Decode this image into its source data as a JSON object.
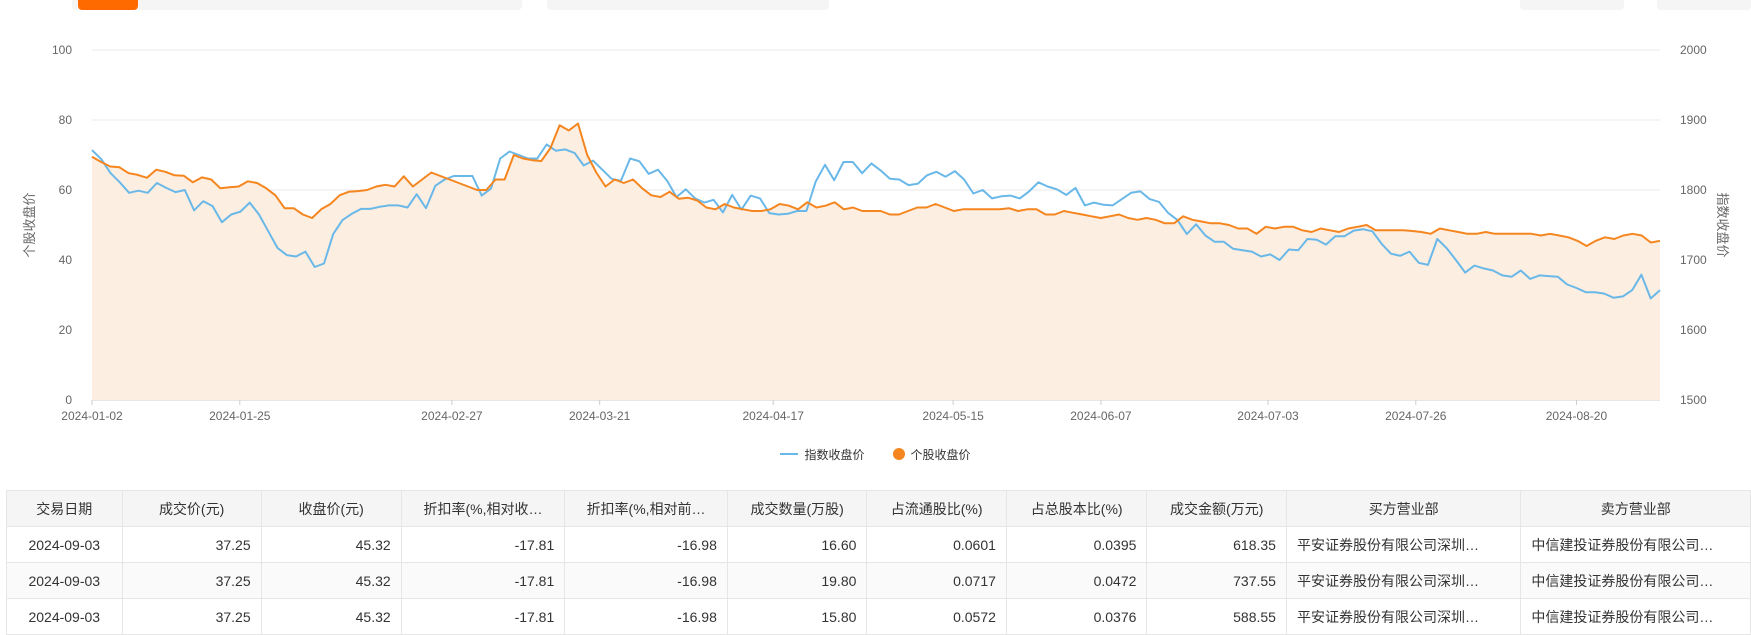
{
  "colors": {
    "index": "#6ab8e8",
    "stock": "#f5861f",
    "area": "#fdeee2",
    "active_tab": "#ff6a00"
  },
  "legend": {
    "index_label": "指数收盘价",
    "stock_label": "个股收盘价"
  },
  "chart_data": {
    "type": "line",
    "x_ticks": [
      "2024-01-02",
      "2024-01-25",
      "2024-02-27",
      "2024-03-21",
      "2024-04-17",
      "2024-05-15",
      "2024-06-07",
      "2024-07-03",
      "2024-07-26",
      "2024-08-20"
    ],
    "xlim": [
      "2024-01-02",
      "2024-09-02"
    ],
    "y_left": {
      "label": "个股收盘价",
      "min": 0,
      "max": 100,
      "ticks": [
        0,
        20,
        40,
        60,
        80,
        100
      ]
    },
    "y_right": {
      "label": "指数收盘价",
      "min": 1500,
      "max": 2000,
      "ticks": [
        1500,
        1600,
        1700,
        1800,
        1900,
        2000
      ]
    },
    "grid": true,
    "legend_position": "bottom",
    "series": [
      {
        "name": "指数收盘价",
        "axis": "right",
        "style": "line",
        "values": [
          1857,
          1844,
          1824,
          1811,
          1796,
          1799,
          1796,
          1810,
          1803,
          1797,
          1800,
          1771,
          1784,
          1777,
          1754,
          1765,
          1769,
          1782,
          1765,
          1741,
          1717,
          1707,
          1705,
          1712,
          1690,
          1695,
          1737,
          1757,
          1766,
          1773,
          1773,
          1776,
          1778,
          1778,
          1775,
          1794,
          1774,
          1806,
          1815,
          1820,
          1820,
          1820,
          1792,
          1802,
          1845,
          1855,
          1850,
          1845,
          1845,
          1865,
          1856,
          1858,
          1853,
          1835,
          1842,
          1829,
          1816,
          1813,
          1845,
          1841,
          1823,
          1829,
          1813,
          1790,
          1801,
          1788,
          1782,
          1786,
          1768,
          1793,
          1772,
          1792,
          1788,
          1767,
          1765,
          1766,
          1770,
          1770,
          1812,
          1836,
          1814,
          1840,
          1840,
          1824,
          1838,
          1828,
          1816,
          1815,
          1807,
          1809,
          1821,
          1826,
          1819,
          1827,
          1815,
          1795,
          1800,
          1788,
          1791,
          1792,
          1788,
          1798,
          1811,
          1805,
          1801,
          1793,
          1803,
          1778,
          1782,
          1779,
          1778,
          1787,
          1796,
          1798,
          1787,
          1783,
          1767,
          1757,
          1737,
          1751,
          1735,
          1726,
          1726,
          1716,
          1714,
          1712,
          1705,
          1708,
          1700,
          1715,
          1714,
          1730,
          1729,
          1722,
          1734,
          1734,
          1742,
          1744,
          1741,
          1723,
          1709,
          1706,
          1712,
          1696,
          1693,
          1730,
          1717,
          1700,
          1682,
          1692,
          1688,
          1685,
          1678,
          1676,
          1685,
          1673,
          1678,
          1677,
          1676,
          1665,
          1660,
          1654,
          1654,
          1652,
          1646,
          1648,
          1657,
          1679,
          1645,
          1657
        ]
      },
      {
        "name": "个股收盘价",
        "axis": "left",
        "style": "area",
        "values": [
          69.5,
          68.0,
          66.7,
          66.5,
          64.8,
          64.3,
          63.5,
          65.8,
          65.2,
          64.2,
          64.1,
          62.2,
          63.6,
          63.0,
          60.5,
          60.8,
          61.0,
          62.5,
          62.0,
          60.5,
          58.5,
          54.8,
          54.8,
          53.0,
          52.0,
          54.5,
          56.0,
          58.5,
          59.5,
          59.7,
          60.0,
          61.0,
          61.5,
          61.0,
          63.9,
          61.0,
          63.0,
          65.0,
          64.0,
          63.0,
          62.0,
          61.0,
          60.0,
          60.0,
          63.0,
          63.0,
          70.0,
          69.0,
          68.5,
          68.3,
          72.0,
          78.5,
          77.0,
          79.0,
          70.0,
          65.0,
          61.0,
          63.0,
          62.0,
          63.0,
          60.5,
          58.5,
          58.0,
          59.5,
          57.5,
          57.8,
          57.0,
          55.0,
          54.5,
          56.0,
          55.0,
          54.5,
          54.0,
          54.0,
          54.5,
          56.0,
          55.5,
          54.5,
          56.5,
          55.0,
          55.5,
          56.5,
          54.5,
          55.0,
          54.0,
          54.0,
          54.0,
          53.0,
          53.0,
          54.0,
          55.0,
          55.0,
          56.0,
          55.0,
          54.0,
          54.5,
          54.5,
          54.5,
          54.5,
          54.5,
          54.8,
          54.0,
          54.5,
          54.5,
          53.0,
          53.0,
          54.0,
          53.5,
          53.0,
          52.5,
          52.0,
          52.5,
          53.0,
          52.0,
          51.5,
          52.0,
          51.5,
          50.5,
          50.5,
          52.5,
          51.5,
          51.0,
          50.5,
          50.5,
          50.0,
          49.0,
          49.0,
          47.5,
          49.5,
          49.0,
          49.5,
          49.5,
          48.5,
          48.0,
          49.0,
          48.5,
          48.0,
          49.0,
          49.5,
          50.0,
          48.5,
          48.5,
          48.5,
          48.5,
          48.3,
          48.0,
          47.5,
          49.0,
          48.5,
          48.0,
          47.5,
          47.5,
          48.0,
          47.5,
          47.5,
          47.5,
          47.5,
          47.5,
          47.0,
          47.5,
          47.0,
          46.5,
          45.5,
          44.0,
          45.5,
          46.5,
          46.0,
          47.0,
          47.5,
          47.0,
          45.0,
          45.5
        ]
      }
    ]
  },
  "table": {
    "headers": [
      "交易日期",
      "成交价(元)",
      "收盘价(元)",
      "折扣率(%,相对收…",
      "折扣率(%,相对前…",
      "成交数量(万股)",
      "占流通股比(%)",
      "占总股本比(%)",
      "成交金额(万元)",
      "买方营业部",
      "卖方营业部"
    ],
    "rows": [
      [
        "2024-09-03",
        "37.25",
        "45.32",
        "-17.81",
        "-16.98",
        "16.60",
        "0.0601",
        "0.0395",
        "618.35",
        "平安证券股份有限公司深圳…",
        "中信建投证券股份有限公司…"
      ],
      [
        "2024-09-03",
        "37.25",
        "45.32",
        "-17.81",
        "-16.98",
        "19.80",
        "0.0717",
        "0.0472",
        "737.55",
        "平安证券股份有限公司深圳…",
        "中信建投证券股份有限公司…"
      ],
      [
        "2024-09-03",
        "37.25",
        "45.32",
        "-17.81",
        "-16.98",
        "15.80",
        "0.0572",
        "0.0376",
        "588.55",
        "平安证券股份有限公司深圳…",
        "中信建投证券股份有限公司…"
      ]
    ]
  }
}
